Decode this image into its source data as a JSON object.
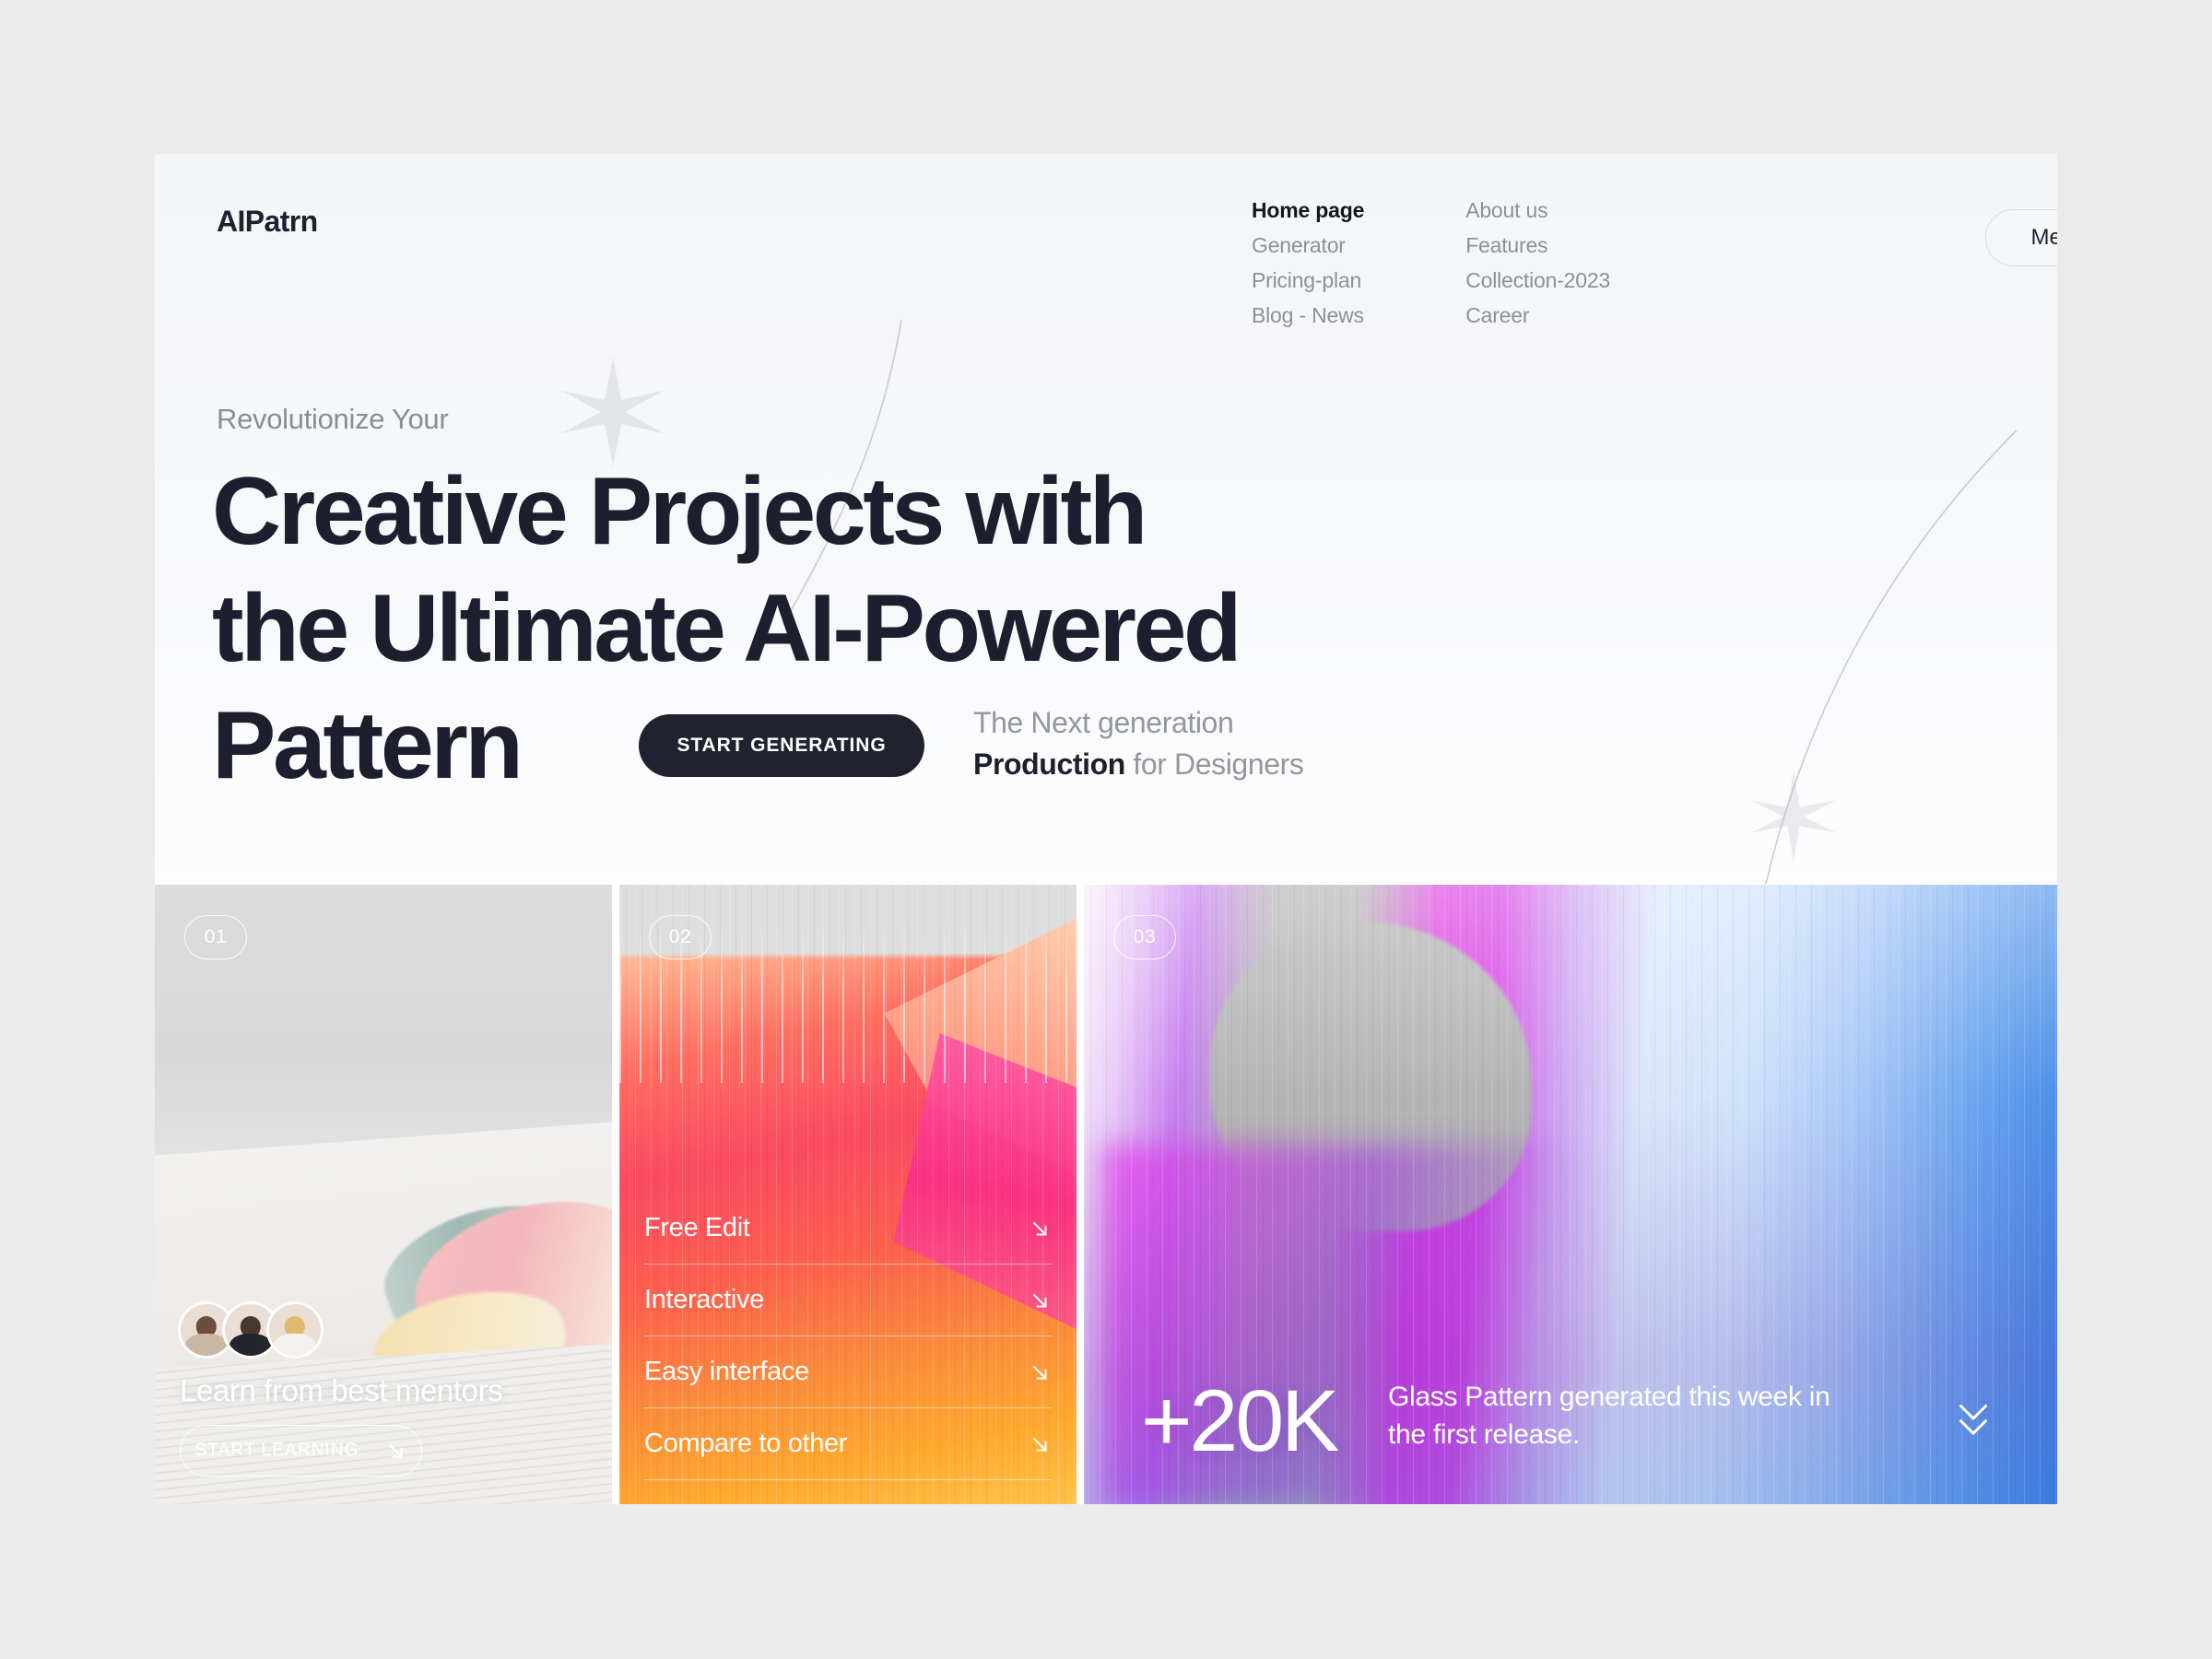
{
  "brand": {
    "logo": "AIPatrn"
  },
  "nav": {
    "column_1": [
      {
        "label": "Home page",
        "active": true
      },
      {
        "label": "Generator",
        "active": false
      },
      {
        "label": "Pricing-plan",
        "active": false
      },
      {
        "label": "Blog - News",
        "active": false
      }
    ],
    "column_2": [
      {
        "label": "About us",
        "active": false
      },
      {
        "label": "Features",
        "active": false
      },
      {
        "label": "Collection-2023",
        "active": false
      },
      {
        "label": "Career",
        "active": false
      }
    ],
    "menu_button": {
      "label": "Menu",
      "icon": "chevron-down-icon"
    }
  },
  "hero": {
    "eyebrow": "Revolutionize Your",
    "headline_line_1": "Creative Projects with",
    "headline_line_2": "the Ultimate AI-Powered",
    "headline_line_3": "Pattern",
    "cta_label": "START GENERATING",
    "tagline_line_1": "The Next generation",
    "tagline_strong": "Production",
    "tagline_rest": " for Designers"
  },
  "cards": [
    {
      "badge": "01",
      "title": "Learn from best mentors",
      "button_label": "START LEARNING",
      "button_icon": "arrow-down-right-icon",
      "avatar_count": 3
    },
    {
      "badge": "02",
      "features": [
        {
          "label": "Free Edit",
          "icon": "arrow-down-right-icon"
        },
        {
          "label": "Interactive",
          "icon": "arrow-down-right-icon"
        },
        {
          "label": "Easy interface",
          "icon": "arrow-down-right-icon"
        },
        {
          "label": "Compare to other",
          "icon": "arrow-down-right-icon"
        }
      ]
    },
    {
      "badge": "03",
      "stat": "+20K",
      "description": "Glass Pattern generated this week in the first release.",
      "scroll_icon": "double-chevron-down-icon"
    }
  ],
  "colors": {
    "page_background": "#ebebeb",
    "surface": "#f5f6f8",
    "ink": "#1d1f2e",
    "muted": "#8d9099",
    "cta": "#20222f"
  }
}
